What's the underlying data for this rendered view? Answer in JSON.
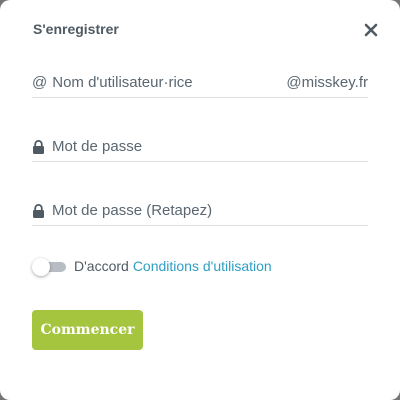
{
  "dialog": {
    "title": "S'enregistrer",
    "close_icon": "close-icon"
  },
  "form": {
    "username": {
      "prefix": "@",
      "placeholder": "Nom d'utilisateur·rice",
      "suffix": "@misskey.fr"
    },
    "password": {
      "icon": "lock-icon",
      "placeholder": "Mot de passe"
    },
    "password_retype": {
      "icon": "lock-icon",
      "placeholder": "Mot de passe (Retapez)"
    },
    "agree": {
      "text": "D'accord",
      "link": "Conditions d'utilisation",
      "checked": false
    },
    "submit_label": "Commencer"
  },
  "colors": {
    "accent": "#a6c53e",
    "link": "#2e9fc4",
    "text": "#5a6670"
  }
}
